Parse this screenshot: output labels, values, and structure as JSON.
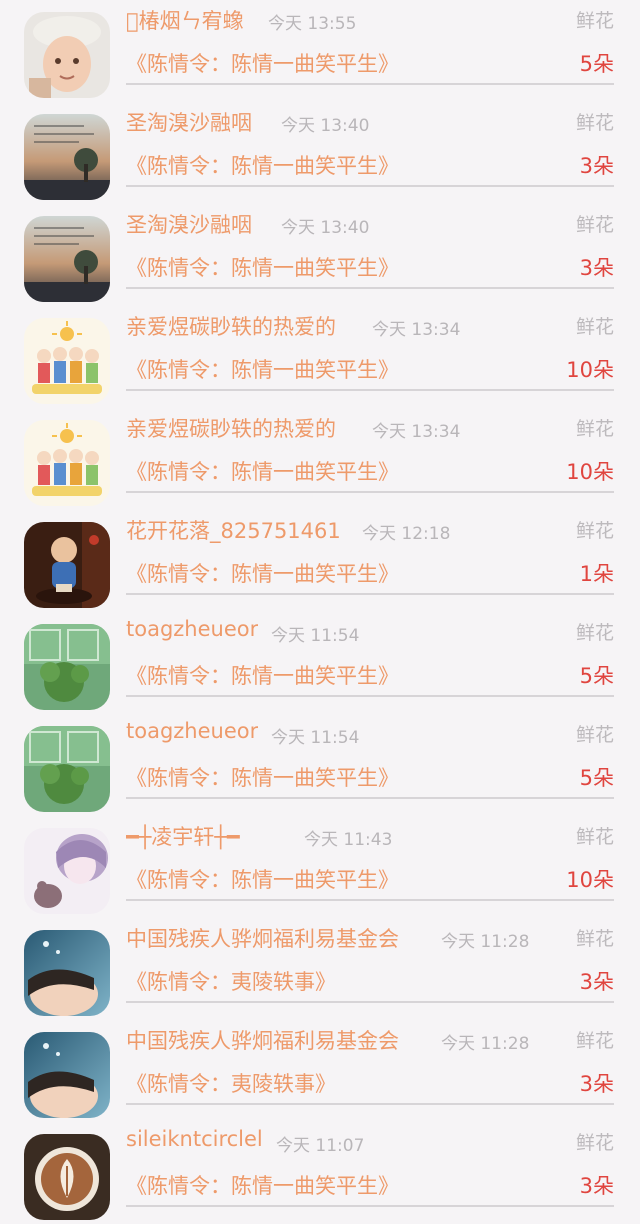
{
  "rows": [
    {
      "name": "\u0000椿烟ㄣ宥蟓",
      "time": "今天 13:55",
      "type": "鲜花",
      "gift": "《陈情令：陈情一曲笑平生》",
      "count": "5朵",
      "avatar": "child-face"
    },
    {
      "name": "圣淘溴沙融咽",
      "time": "今天 13:40",
      "type": "鲜花",
      "gift": "《陈情令：陈情一曲笑平生》",
      "count": "3朵",
      "avatar": "sunset-tree"
    },
    {
      "name": "圣淘溴沙融咽",
      "time": "今天 13:40",
      "type": "鲜花",
      "gift": "《陈情令：陈情一曲笑平生》",
      "count": "3朵",
      "avatar": "sunset-tree"
    },
    {
      "name": "亲爱煜碳眇轶的热爱的",
      "time": "今天 13:34",
      "type": "鲜花",
      "gift": "《陈情令：陈情一曲笑平生》",
      "count": "10朵",
      "avatar": "cartoon-family"
    },
    {
      "name": "亲爱煜碳眇轶的热爱的",
      "time": "今天 13:34",
      "type": "鲜花",
      "gift": "《陈情令：陈情一曲笑平生》",
      "count": "10朵",
      "avatar": "cartoon-family"
    },
    {
      "name": "花开花落_825751461",
      "time": "今天 12:18",
      "type": "鲜花",
      "gift": "《陈情令：陈情一曲笑平生》",
      "count": "1朵",
      "avatar": "monk-figure"
    },
    {
      "name": "toagzheueor",
      "time": "今天 11:54",
      "type": "鲜花",
      "gift": "《陈情令：陈情一曲笑平生》",
      "count": "5朵",
      "avatar": "green-window"
    },
    {
      "name": "toagzheueor",
      "time": "今天 11:54",
      "type": "鲜花",
      "gift": "《陈情令：陈情一曲笑平生》",
      "count": "5朵",
      "avatar": "green-window"
    },
    {
      "name": "━┼凌宇轩┼━",
      "time": "今天 11:43",
      "type": "鲜花",
      "gift": "《陈情令：陈情一曲笑平生》",
      "count": "10朵",
      "avatar": "anime-girl"
    },
    {
      "name": "中国残疾人骅炯福利易基金会",
      "time": "今天 11:28",
      "type": "鲜花",
      "gift": "《陈情令：夷陵轶事》",
      "count": "3朵",
      "avatar": "sky-person"
    },
    {
      "name": "中国残疾人骅炯福利易基金会",
      "time": "今天 11:28",
      "type": "鲜花",
      "gift": "《陈情令：夷陵轶事》",
      "count": "3朵",
      "avatar": "sky-person"
    },
    {
      "name": "sileikntcirclel",
      "time": "今天 11:07",
      "type": "鲜花",
      "gift": "《陈情令：陈情一曲笑平生》",
      "count": "3朵",
      "avatar": "latte-art"
    }
  ]
}
